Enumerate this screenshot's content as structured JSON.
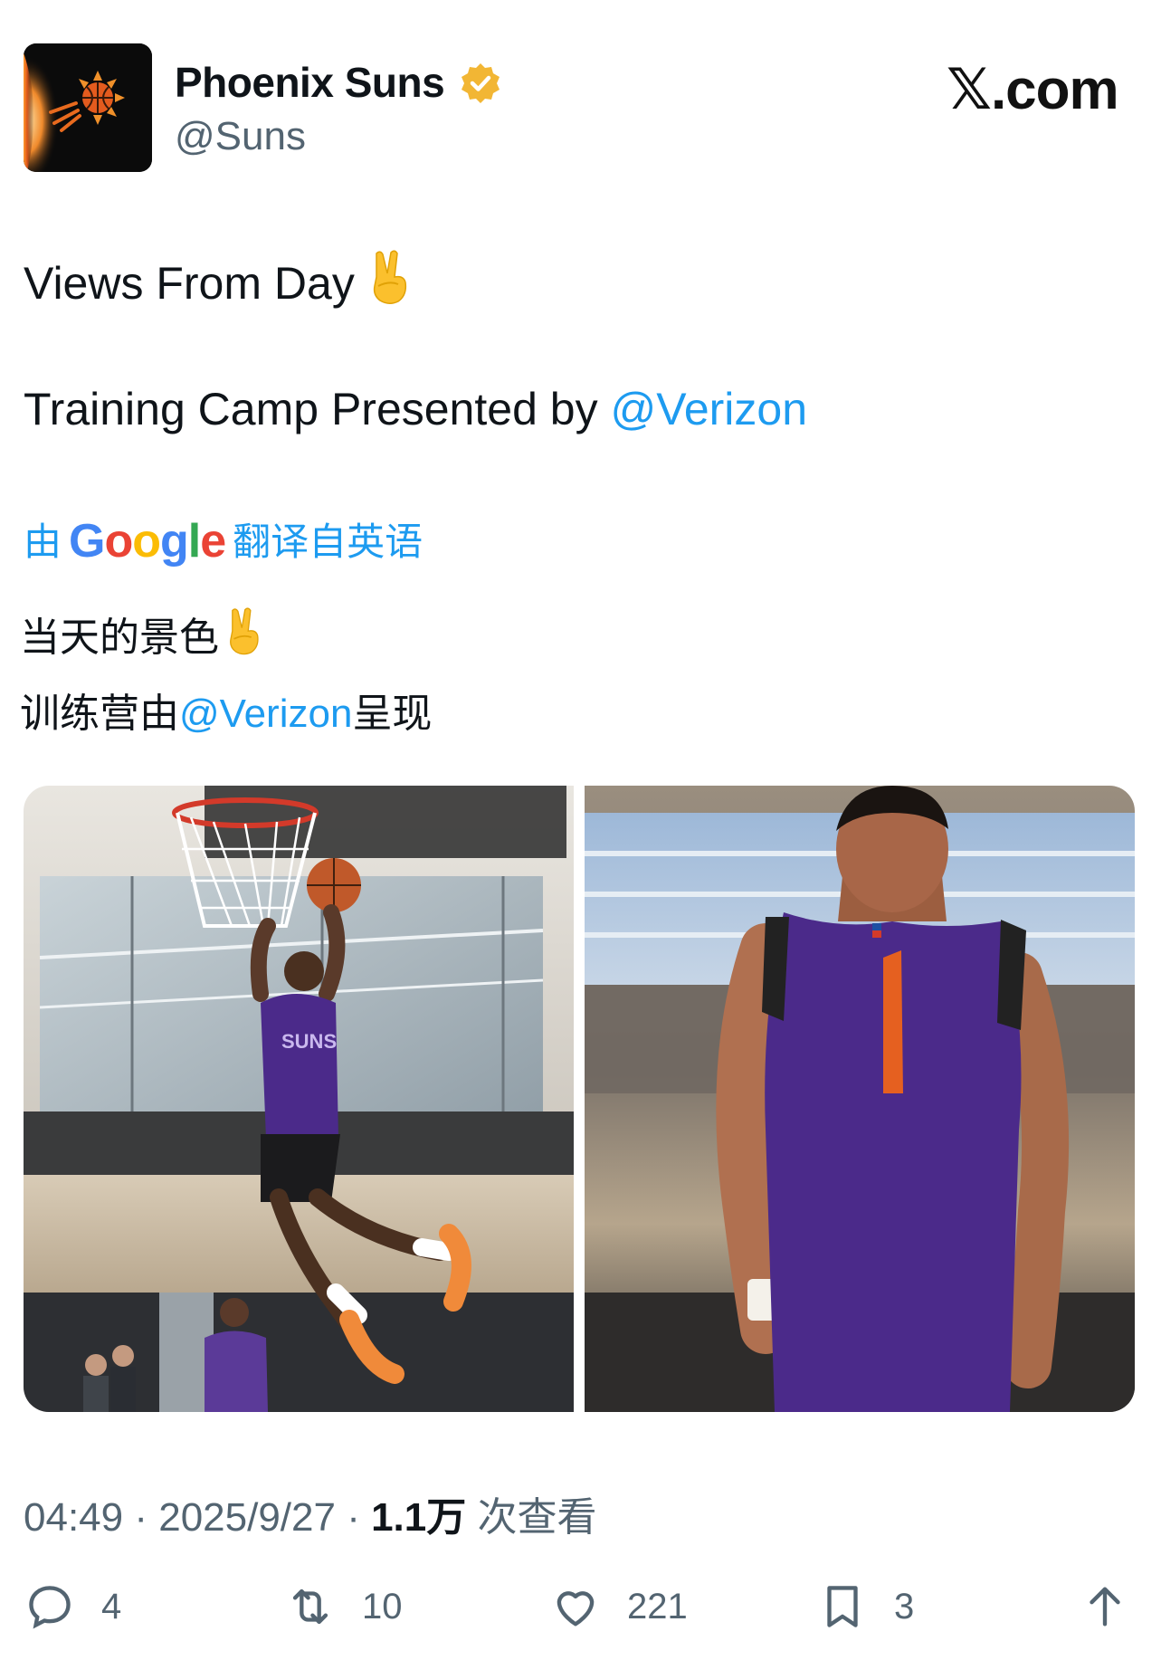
{
  "author": {
    "display_name": "Phoenix Suns",
    "handle": "@Suns",
    "verified_badge": "verified-gold-icon",
    "avatar": "phoenix-suns-logo"
  },
  "site": {
    "brand": "𝕏.com"
  },
  "tweet": {
    "line1": "Views From Day",
    "line1_emoji": "victory-hand-icon",
    "line2_prefix": "Training Camp Presented by ",
    "line2_mention": "@Verizon"
  },
  "translation": {
    "prefix": "由",
    "provider_letters": [
      "G",
      "o",
      "o",
      "g",
      "l",
      "e"
    ],
    "suffix": "翻译自英语",
    "line1": "当天的景色",
    "line1_emoji": "victory-hand-icon",
    "line2_prefix": "训练营由",
    "line2_mention": "@Verizon",
    "line2_suffix": "呈现"
  },
  "media": [
    {
      "name": "photo-dunk",
      "icon": "image-photo"
    },
    {
      "name": "photo-back-number-1",
      "icon": "image-photo"
    }
  ],
  "meta": {
    "time": "04:49",
    "sep1": " · ",
    "date": "2025/9/27",
    "sep2": " · ",
    "views_value": "1.1万",
    "views_label": " 次查看"
  },
  "actions": {
    "replies": "4",
    "retweets": "10",
    "likes": "221",
    "bookmarks": "3"
  },
  "colors": {
    "accent": "#1d9bf0",
    "text": "#0f1419",
    "muted": "#536471",
    "jersey_purple": "#4b2a8a",
    "suns_orange": "#e56020"
  }
}
